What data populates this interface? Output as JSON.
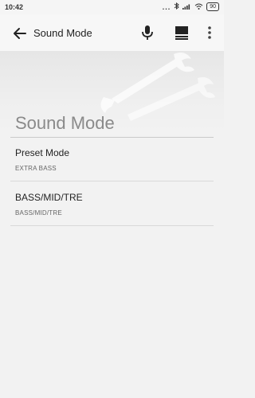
{
  "status": {
    "time": "10:42",
    "indicators": "...",
    "battery": "90"
  },
  "appbar": {
    "title": "Sound Mode",
    "icons": [
      "back-arrow-icon",
      "microphone-icon",
      "queue-icon",
      "more-vertical-icon"
    ]
  },
  "section": {
    "title": "Sound Mode"
  },
  "items": [
    {
      "label": "Preset Mode",
      "value": "EXTRA BASS"
    },
    {
      "label": "BASS/MID/TRE",
      "value": "BASS/MID/TRE"
    }
  ]
}
